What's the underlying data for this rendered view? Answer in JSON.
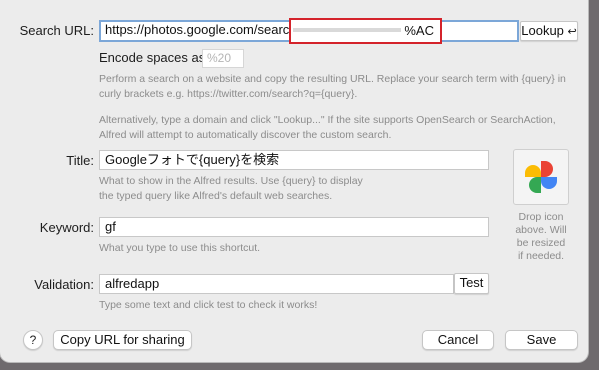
{
  "search_url": {
    "label": "Search URL:",
    "value": "https://photos.google.com/search/%E3%83%95%E3%82%A9%E3%83%88%E3%82%92%E6%A4%9C%E7%B4%A2",
    "visible_value_prefix": "https://photos.google.com/search/%E",
    "visible_value_suffix": "%AC",
    "lookup_button": "Lookup",
    "lookup_icon": "return-key-icon"
  },
  "encode": {
    "label": "Encode spaces as",
    "placeholder": "%20"
  },
  "url_help": {
    "line1": "Perform a search on a website and copy the resulting URL. Replace your search term with {query} in",
    "line2": "curly brackets e.g. https://twitter.com/search?q={query}.",
    "line3": "Alternatively, type a domain and click \"Lookup...\" If the site supports OpenSearch or SearchAction,",
    "line4": "Alfred will attempt to automatically discover the custom search."
  },
  "title": {
    "label": "Title:",
    "value": "Googleフォトで{query}を検索",
    "help_line1": "What to show in the Alfred results. Use {query} to display",
    "help_line2": "the typed query like Alfred's default web searches."
  },
  "keyword": {
    "label": "Keyword:",
    "value": "gf",
    "help": "What you type to use this shortcut."
  },
  "validation": {
    "label": "Validation:",
    "value": "alfredapp",
    "test_button": "Test",
    "help": "Type some text and click test to check it works!"
  },
  "icon_well": {
    "icon": "google-photos-pinwheel-icon",
    "caption_line1": "Drop icon",
    "caption_line2": "above. Will",
    "caption_line3": "be resized",
    "caption_line4": "if needed."
  },
  "footer": {
    "help_button": "?",
    "copy_button": "Copy URL for sharing",
    "cancel_button": "Cancel",
    "save_button": "Save"
  },
  "colors": {
    "highlight_box": "#d4232b",
    "focus_ring": "#7ca7d8",
    "dialog_bg": "#ececec",
    "help_text": "#8c8c8c"
  }
}
